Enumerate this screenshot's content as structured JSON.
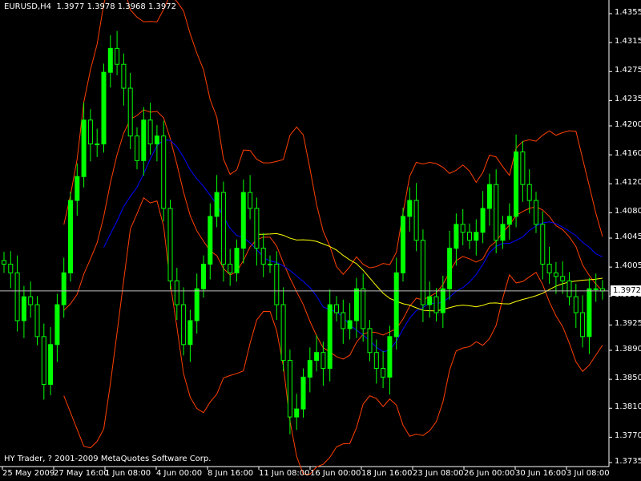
{
  "header": {
    "symbol": "EURUSD,H4",
    "open": "1.3977",
    "high": "1.3978",
    "low": "1.3968",
    "close": "1.3972"
  },
  "footer": {
    "copyright": "HY Trader, ? 2001-2009 MetaQuotes Software Corp."
  },
  "colors": {
    "background": "#000000",
    "bull": "#00ff00",
    "bear": "#000000",
    "bollinger": "#ff4000",
    "ma_fast": "#0000ff",
    "ma_slow": "#ffff00",
    "axis": "#ffffff",
    "price_line": "#c0c0c0"
  },
  "chart_data": {
    "type": "candlestick",
    "title": "EURUSD,H4",
    "ylim": [
      1.3735,
      1.4355
    ],
    "y_ticks": [
      "1.4355",
      "1.4315",
      "1.4275",
      "1.4235",
      "1.4200",
      "1.4160",
      "1.4120",
      "1.4080",
      "1.4045",
      "1.4005",
      "1.3965",
      "1.3925",
      "1.3890",
      "1.3850",
      "1.3810",
      "1.3770",
      "1.3735"
    ],
    "x_ticks": [
      "25 May 2009",
      "27 May 16:00",
      "1 Jun 08:00",
      "4 Jun 00:00",
      "8 Jun 16:00",
      "11 Jun 08:00",
      "16 Jun 00:00",
      "18 Jun 16:00",
      "23 Jun 08:00",
      "26 Jun 00:00",
      "30 Jun 16:00",
      "3 Jul 08:00"
    ],
    "current_price": "1.3972",
    "closes": [
      1.4009,
      1.3997,
      1.3931,
      1.3964,
      1.3953,
      1.3909,
      1.3843,
      1.3898,
      1.3953,
      1.3997,
      1.4097,
      1.413,
      1.4208,
      1.4175,
      1.4175,
      1.4274,
      1.4307,
      1.4285,
      1.4252,
      1.4186,
      1.4152,
      1.4208,
      1.4175,
      1.4186,
      1.4086,
      1.3986,
      1.3953,
      1.3898,
      1.3931,
      1.3975,
      1.4009,
      1.4075,
      1.4108,
      1.4009,
      1.3997,
      1.4031,
      1.4108,
      1.4086,
      1.4031,
      1.4009,
      1.4009,
      1.3953,
      1.3876,
      1.3798,
      1.3809,
      1.3853,
      1.3876,
      1.3887,
      1.3865,
      1.3953,
      1.3942,
      1.392,
      1.3931,
      1.3975,
      1.392,
      1.3887,
      1.3865,
      1.3853,
      1.3909,
      1.3997,
      1.4075,
      1.4097,
      1.4042,
      1.3953,
      1.3964,
      1.3942,
      1.3975,
      1.4031,
      1.4064,
      1.4053,
      1.4042,
      1.4053,
      1.4086,
      1.4119,
      1.4042,
      1.4064,
      1.4075,
      1.4164,
      1.4119,
      1.4097,
      1.4064,
      1.4009,
      1.3997,
      1.3992,
      1.3986,
      1.3964,
      1.3942,
      1.3909,
      1.3975,
      1.3975,
      1.3972
    ],
    "indicators": [
      "bollinger-bands",
      "moving-average-fast",
      "moving-average-slow"
    ]
  }
}
